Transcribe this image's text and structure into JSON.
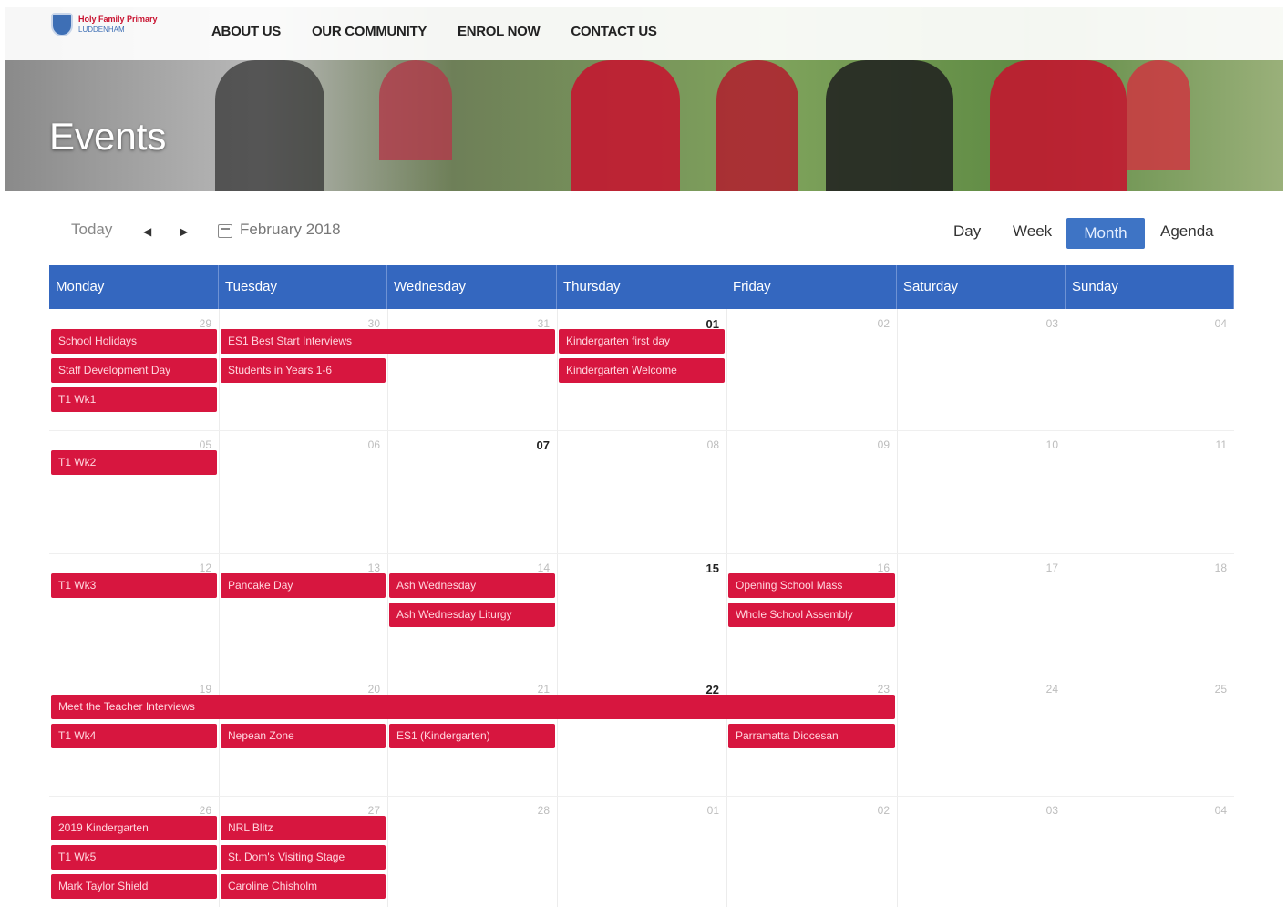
{
  "header": {
    "logo_line1": "Holy Family Primary",
    "logo_line2": "LUDDENHAM",
    "nav": [
      "ABOUT US",
      "OUR COMMUNITY",
      "ENROL NOW",
      "CONTACT US"
    ],
    "page_title": "Events"
  },
  "toolbar": {
    "today": "Today",
    "prev": "◀",
    "next": "▶",
    "month_label": "February 2018",
    "views": [
      "Day",
      "Week",
      "Month",
      "Agenda"
    ],
    "active_view": "Month"
  },
  "calendar": {
    "day_headers": [
      "Monday",
      "Tuesday",
      "Wednesday",
      "Thursday",
      "Friday",
      "Saturday",
      "Sunday"
    ],
    "weeks": [
      {
        "days": [
          "29",
          "30",
          "31",
          "01",
          "02",
          "03",
          "04"
        ],
        "highlight": [
          3
        ]
      },
      {
        "days": [
          "05",
          "06",
          "07",
          "08",
          "09",
          "10",
          "11"
        ],
        "highlight": [
          2
        ]
      },
      {
        "days": [
          "12",
          "13",
          "14",
          "15",
          "16",
          "17",
          "18"
        ],
        "highlight": [
          3
        ]
      },
      {
        "days": [
          "19",
          "20",
          "21",
          "22",
          "23",
          "24",
          "25"
        ],
        "highlight": [
          3
        ]
      },
      {
        "days": [
          "26",
          "27",
          "28",
          "01",
          "02",
          "03",
          "04"
        ],
        "highlight": []
      }
    ],
    "events": [
      {
        "label": "School Holidays",
        "week": 0,
        "start": 0,
        "span": 1,
        "row": 0
      },
      {
        "label": "ES1 Best Start Interviews",
        "week": 0,
        "start": 1,
        "span": 2,
        "row": 0
      },
      {
        "label": "Kindergarten first day",
        "week": 0,
        "start": 3,
        "span": 1,
        "row": 0
      },
      {
        "label": "Staff Development Day",
        "week": 0,
        "start": 0,
        "span": 1,
        "row": 1
      },
      {
        "label": "Students in Years 1-6",
        "week": 0,
        "start": 1,
        "span": 1,
        "row": 1
      },
      {
        "label": "Kindergarten Welcome",
        "week": 0,
        "start": 3,
        "span": 1,
        "row": 1
      },
      {
        "label": "T1 Wk1",
        "week": 0,
        "start": 0,
        "span": 1,
        "row": 2
      },
      {
        "label": "T1 Wk2",
        "week": 1,
        "start": 0,
        "span": 1,
        "row": 0
      },
      {
        "label": "T1 Wk3",
        "week": 2,
        "start": 0,
        "span": 1,
        "row": 0
      },
      {
        "label": "Pancake Day",
        "week": 2,
        "start": 1,
        "span": 1,
        "row": 0
      },
      {
        "label": "Ash Wednesday",
        "week": 2,
        "start": 2,
        "span": 1,
        "row": 0
      },
      {
        "label": "Opening School Mass",
        "week": 2,
        "start": 4,
        "span": 1,
        "row": 0
      },
      {
        "label": "Ash Wednesday Liturgy",
        "week": 2,
        "start": 2,
        "span": 1,
        "row": 1
      },
      {
        "label": "Whole School Assembly",
        "week": 2,
        "start": 4,
        "span": 1,
        "row": 1
      },
      {
        "label": "Meet the Teacher Interviews",
        "week": 3,
        "start": 0,
        "span": 5,
        "row": 0
      },
      {
        "label": "T1 Wk4",
        "week": 3,
        "start": 0,
        "span": 1,
        "row": 1
      },
      {
        "label": "Nepean Zone",
        "week": 3,
        "start": 1,
        "span": 1,
        "row": 1
      },
      {
        "label": "ES1 (Kindergarten)",
        "week": 3,
        "start": 2,
        "span": 1,
        "row": 1
      },
      {
        "label": "Parramatta Diocesan",
        "week": 3,
        "start": 4,
        "span": 1,
        "row": 1
      },
      {
        "label": "2019 Kindergarten",
        "week": 4,
        "start": 0,
        "span": 1,
        "row": 0
      },
      {
        "label": "NRL Blitz",
        "week": 4,
        "start": 1,
        "span": 1,
        "row": 0
      },
      {
        "label": "T1 Wk5",
        "week": 4,
        "start": 0,
        "span": 1,
        "row": 1
      },
      {
        "label": "St. Dom's Visiting Stage",
        "week": 4,
        "start": 1,
        "span": 1,
        "row": 1
      },
      {
        "label": "Mark Taylor Shield",
        "week": 4,
        "start": 0,
        "span": 1,
        "row": 2
      },
      {
        "label": "Caroline Chisholm",
        "week": 4,
        "start": 1,
        "span": 1,
        "row": 2
      }
    ]
  },
  "colors": {
    "header_blue": "#3467bf",
    "active_view": "#3e74c5",
    "event_red": "#d7163f"
  }
}
